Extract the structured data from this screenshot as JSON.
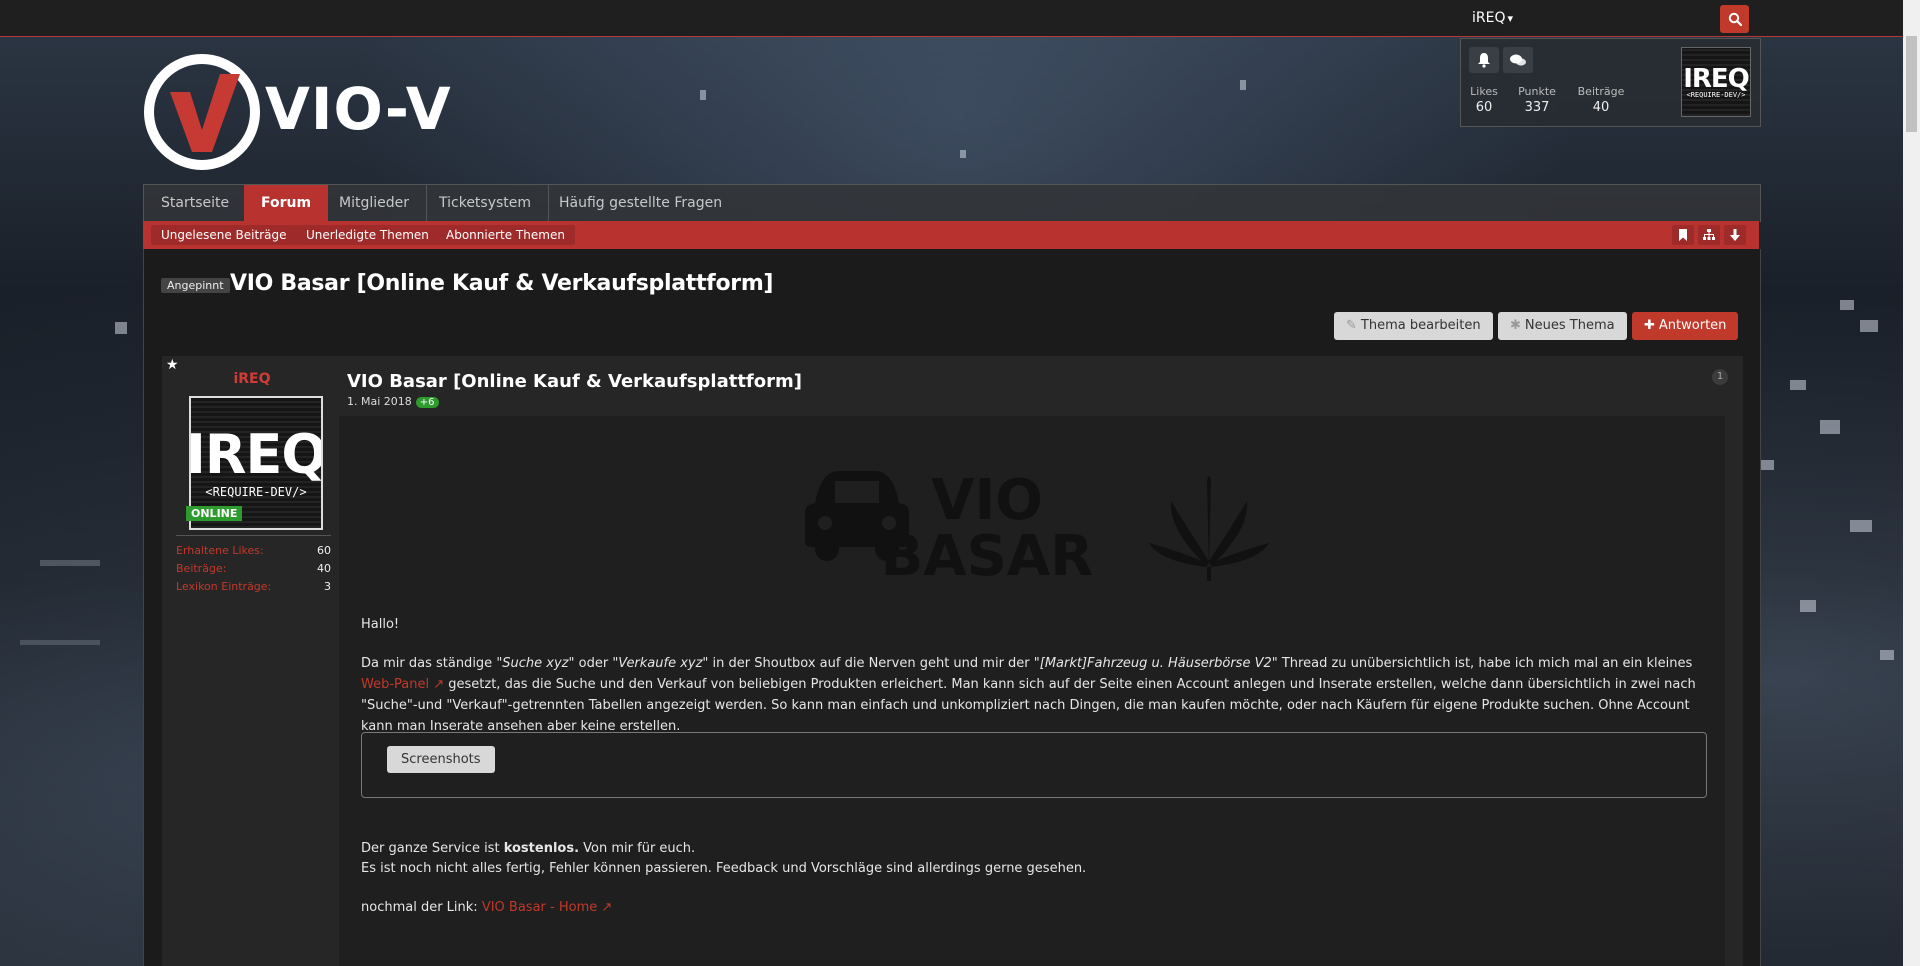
{
  "user_menu": {
    "username": "iREQ",
    "caret": "⌄"
  },
  "user_panel": {
    "stats": [
      {
        "label": "Likes",
        "value": "60"
      },
      {
        "label": "Punkte",
        "value": "337"
      },
      {
        "label": "Beiträge",
        "value": "40"
      }
    ]
  },
  "logo": {
    "text": "VIO-V"
  },
  "nav": {
    "tabs": [
      {
        "label": "Startseite"
      },
      {
        "label": "Forum",
        "active": true
      },
      {
        "label": "Mitglieder"
      },
      {
        "label": "Ticketsystem"
      },
      {
        "label": "Häufig gestellte Fragen"
      }
    ],
    "subnav": [
      {
        "label": "Ungelesene Beiträge"
      },
      {
        "label": "Unerledigte Themen"
      },
      {
        "label": "Abonnierte Themen"
      }
    ]
  },
  "thread": {
    "pinned_label": "Angepinnt",
    "title": "VIO Basar [Online Kauf & Verkaufsplattform]",
    "buttons": {
      "edit": "Thema bearbeiten",
      "new": "Neues Thema",
      "reply": "Antworten"
    }
  },
  "post": {
    "author": "iREQ",
    "avatar_text_big": "IREQ",
    "avatar_text_small": "<REQUIRE-DEV/>",
    "online": "ONLINE",
    "author_stats": [
      {
        "label": "Erhaltene Likes:",
        "value": "60"
      },
      {
        "label": "Beiträge:",
        "value": "40"
      },
      {
        "label": "Lexikon Einträge:",
        "value": "3"
      }
    ],
    "title": "VIO Basar [Online Kauf & Verkaufsplattform]",
    "date": "1. Mai 2018",
    "reactions": "+6",
    "number": "1",
    "banner_line1": "VIO",
    "banner_line2": "BASAR",
    "greeting": "Hallo!",
    "para1_a": "Da mir das ständige ",
    "para1_q1": "\"Suche xyz\"",
    "para1_b": " oder ",
    "para1_q2": "\"Verkaufe xyz\"",
    "para1_c": " in der Shoutbox auf die Nerven geht und mir der ",
    "para1_q3": "\"[Markt]Fahrzeug u. Häuserbörse V2\"",
    "para1_d": " Thread zu unübersichtlich ist, habe ich mich mal an ein kleines ",
    "para1_link": "Web-Panel",
    "para1_e": " gesetzt, das die Suche und den Verkauf von beliebigen Produkten erleichert. Man kann sich auf der Seite einen Account anlegen und Inserate erstellen, welche dann übersichtlich in zwei nach \"Suche\"-und \"Verkauf\"-getrennten Tabellen angezeigt werden. So kann man einfach und unkompliziert nach Dingen, die man kaufen möchte, oder nach Käufern für eigene Produkte suchen. Ohne Account kann man Inserate ansehen aber keine erstellen.",
    "spoiler_label": "Screenshots",
    "para2_a": "Der ganze Service ist ",
    "para2_bold": "kostenlos.",
    "para2_b": " Von mir für euch.",
    "para3": "Es ist noch nicht alles fertig, Fehler können passieren. Feedback und Vorschläge sind allerdings gerne gesehen.",
    "para4_a": "nochmal der Link: ",
    "para4_link": "VIO Basar - Home"
  },
  "colors": {
    "accent": "#b8322f",
    "online": "#2e9b2e"
  }
}
